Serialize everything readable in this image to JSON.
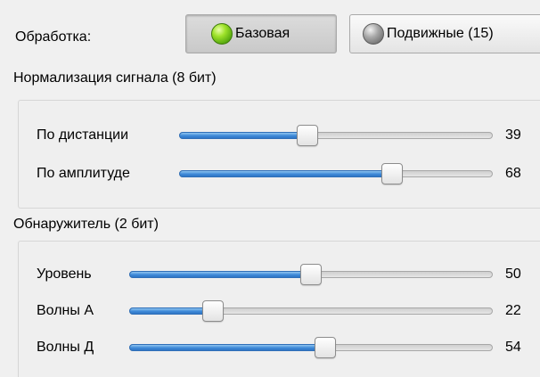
{
  "processing": {
    "label": "Обработка:",
    "buttons": [
      {
        "label": "Базовая",
        "active": true,
        "led": "green"
      },
      {
        "label": "Подвижные (15)",
        "active": false,
        "led": "gray"
      }
    ]
  },
  "normalization": {
    "title": "Нормализация сигнала (8 бит)",
    "sliders": [
      {
        "label": "По дистанции",
        "value": 39,
        "fraction": 0.41
      },
      {
        "label": "По амплитуде",
        "value": 68,
        "fraction": 0.68
      }
    ]
  },
  "detector": {
    "title": "Обнаружитель (2 бит)",
    "sliders": [
      {
        "label": "Уровень",
        "value": 50,
        "fraction": 0.5
      },
      {
        "label": "Волны А",
        "value": 22,
        "fraction": 0.23
      },
      {
        "label": "Волны Д",
        "value": 54,
        "fraction": 0.54
      }
    ]
  },
  "colors": {
    "slider_fill": "#3f8ad8",
    "led_active": "#7ccb1a",
    "led_inactive": "#8a8a8a"
  }
}
